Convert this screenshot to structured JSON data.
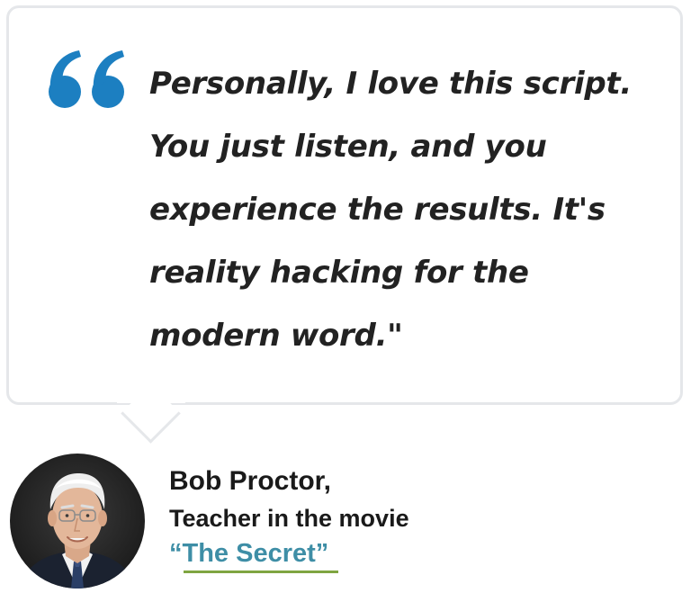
{
  "testimonial": {
    "quote_lines": [
      "Personally, I love this script.",
      "You just listen, and you",
      "experience the results. It's",
      "reality hacking for the",
      "modern word.\""
    ],
    "quote_icon": "double-quote-icon",
    "author": {
      "name": "Bob Proctor,",
      "role": "Teacher in the movie",
      "movie": "“The Secret”",
      "avatar": "author-portrait"
    }
  },
  "colors": {
    "quote_icon": "#1c7fc1",
    "movie_link": "#3e8ea6",
    "movie_underline": "#7fa541",
    "bubble_border": "#e5e7ea",
    "text": "#222222"
  }
}
